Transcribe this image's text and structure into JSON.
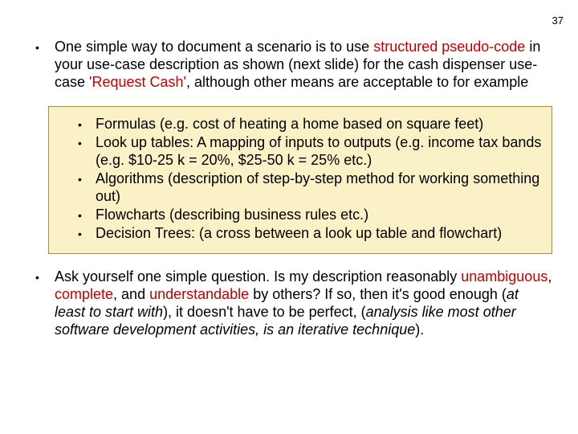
{
  "page_number": "37",
  "bullets": {
    "first": {
      "pre": "One simple way to document a scenario is to use ",
      "red1": "structured pseudo-code",
      "mid1": " in your use-case description as shown (next slide) for the cash dispenser use-case ",
      "red2": "'Request Cash'",
      "post": ", although other means are acceptable to for example"
    },
    "sub": [
      "Formulas (e.g. cost of heating a home based on square feet)",
      "Look up tables: A mapping of inputs to outputs (e.g. income tax bands (e.g. $10-25 k = 20%, $25-50 k = 25% etc.)",
      "Algorithms (description of step-by-step method for working something out)",
      "Flowcharts (describing business rules etc.)",
      "Decision Trees: (a cross between a look up table and flowchart)"
    ],
    "second": {
      "pre": "Ask yourself one simple question. Is my description reasonably ",
      "red1": "unambiguous",
      "sep1": ", ",
      "red2": "complete",
      "sep2": ", and ",
      "red3": "understandable",
      "mid": " by others? If so, then it's good enough (",
      "ital1": "at least to start with",
      "mid2": "), it doesn't have to be perfect, (",
      "ital2": "analysis like most other software development activities, is an iterative technique",
      "post": ")."
    }
  }
}
